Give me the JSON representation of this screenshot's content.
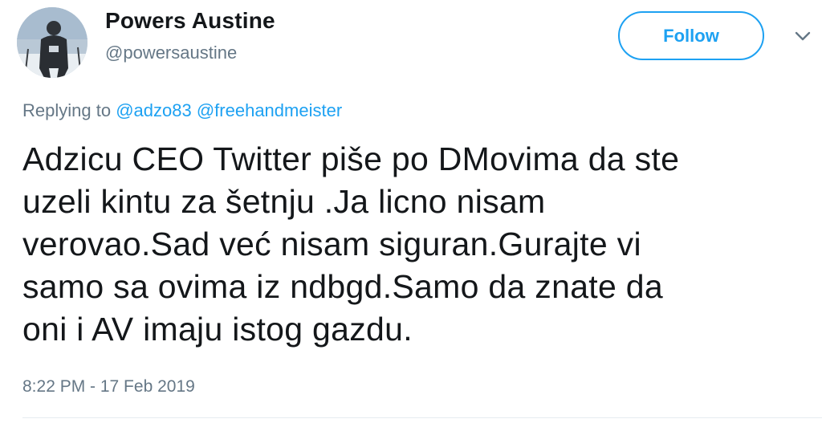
{
  "author": {
    "name": "Powers Austine",
    "handle": "@powersaustine"
  },
  "follow_button": {
    "label": "Follow"
  },
  "more_menu": {
    "icon": "chevron-down-icon"
  },
  "reply_context": {
    "prefix": "Replying to",
    "mentions": [
      "@adzo83",
      "@freehandmeister"
    ]
  },
  "tweet": {
    "lines": [
      "Adzicu CEO Twitter piše po DMovima da ste",
      "uzeli kintu za šetnju .Ja licno nisam",
      "verovao.Sad već nisam siguran.Gurajte vi",
      "samo sa ovima iz ndbgd.Samo da znate da",
      "oni i AV imaju istog gazdu."
    ],
    "timestamp": "8:22 PM - 17 Feb 2019"
  },
  "colors": {
    "accent": "#1da1f2",
    "secondary_text": "#657786",
    "primary_text": "#14171a"
  }
}
